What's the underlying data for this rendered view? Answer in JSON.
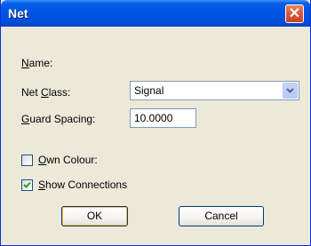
{
  "window": {
    "title": "Net",
    "close_glyph": "✕"
  },
  "form": {
    "name_label": "Name:",
    "net_class_label": "Net Class:",
    "net_class_value": "Signal",
    "guard_spacing_label": "Guard Spacing:",
    "guard_spacing_value": "10.0000",
    "own_colour_label": "Own Colour:",
    "own_colour_checked": false,
    "show_connections_label": "Show Connections",
    "show_connections_checked": true
  },
  "buttons": {
    "ok": "OK",
    "cancel": "Cancel"
  },
  "icons": {
    "close": "close-icon",
    "dropdown": "chevron-down-icon",
    "check": "checkmark-icon"
  },
  "colors": {
    "titlebar": "#0054e3",
    "dialog_bg": "#ece9d8",
    "close_button": "#d9583b",
    "field_border": "#7f9db9"
  }
}
